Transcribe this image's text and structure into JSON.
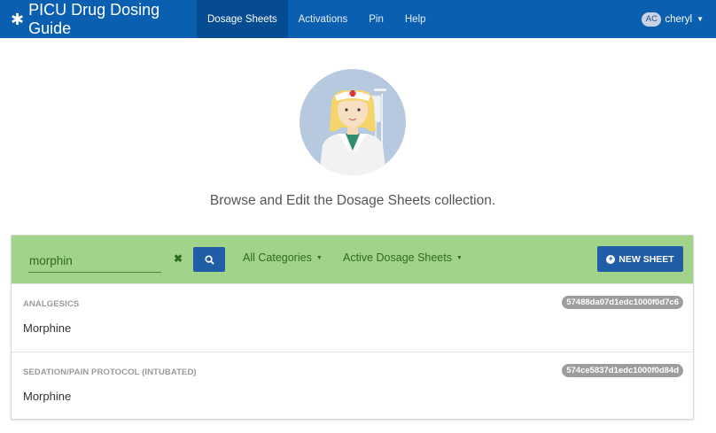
{
  "app": {
    "title": "PICU Drug Dosing Guide",
    "brand_icon": "asterisk-logo-icon"
  },
  "nav": {
    "items": [
      {
        "label": "Dosage Sheets",
        "active": true
      },
      {
        "label": "Activations",
        "active": false
      },
      {
        "label": "Pin",
        "active": false
      },
      {
        "label": "Help",
        "active": false
      }
    ]
  },
  "user": {
    "initials": "AC",
    "name": "cheryl"
  },
  "hero": {
    "image": "nurse-illustration",
    "text": "Browse and Edit the Dosage Sheets collection."
  },
  "toolbar": {
    "search_value": "morphin",
    "category_filter": "All Categories",
    "status_filter": "Active Dosage Sheets",
    "new_button_label": "NEW SHEET"
  },
  "results": [
    {
      "category": "ANALGESICS",
      "name": "Morphine",
      "id": "57488da07d1edc1000f0d7c6"
    },
    {
      "category": "SEDATION/PAIN PROTOCOL (INTUBATED)",
      "name": "Morphine",
      "id": "574ce5837d1edc1000f0d84d"
    }
  ],
  "colors": {
    "navbar": "#0b5fb0",
    "toolbar": "#a2d38a",
    "primary_button": "#1f5da7"
  }
}
